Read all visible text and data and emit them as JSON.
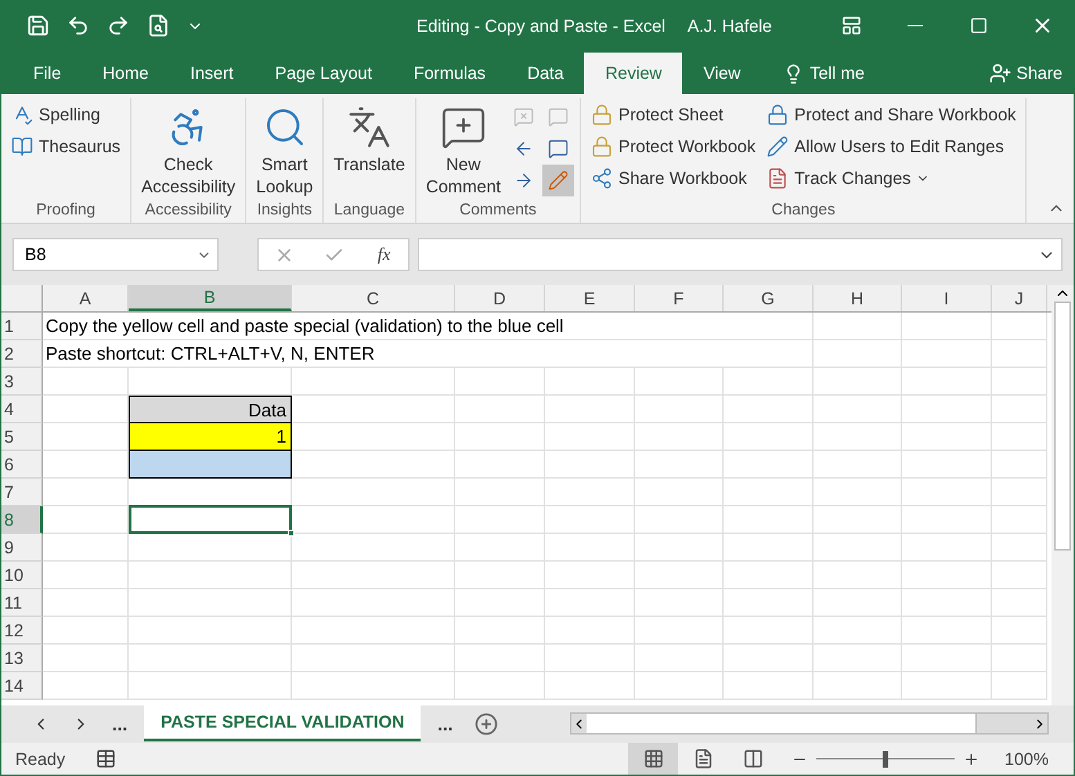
{
  "window": {
    "title": "Editing - Copy and Paste  -  Excel",
    "user": "A.J. Hafele"
  },
  "tabs": [
    {
      "label": "File",
      "selected": false
    },
    {
      "label": "Home",
      "selected": false
    },
    {
      "label": "Insert",
      "selected": false
    },
    {
      "label": "Page Layout",
      "selected": false
    },
    {
      "label": "Formulas",
      "selected": false
    },
    {
      "label": "Data",
      "selected": false
    },
    {
      "label": "Review",
      "selected": true
    },
    {
      "label": "View",
      "selected": false
    }
  ],
  "tell_me": "Tell me",
  "share": "Share",
  "ribbon": [
    {
      "label": "Proofing",
      "kind": "stack",
      "commands": [
        {
          "label": "Spelling"
        },
        {
          "label": "Thesaurus"
        }
      ]
    },
    {
      "label": "Accessibility",
      "kind": "large",
      "commands": [
        {
          "label": "Check Accessibility"
        }
      ]
    },
    {
      "label": "Insights",
      "kind": "large",
      "commands": [
        {
          "label": "Smart Lookup"
        }
      ]
    },
    {
      "label": "Language",
      "kind": "large",
      "commands": [
        {
          "label": "Translate"
        }
      ]
    },
    {
      "label": "Comments",
      "kind": "comments",
      "commands": [
        {
          "label": "New Comment"
        }
      ],
      "icons": [
        {
          "disabled": true,
          "selected": false
        },
        {
          "disabled": true,
          "selected": false
        },
        {
          "disabled": false,
          "selected": false
        },
        {
          "disabled": false,
          "selected": false
        },
        {
          "disabled": false,
          "selected": false
        },
        {
          "disabled": false,
          "selected": true
        }
      ]
    },
    {
      "label": "Changes",
      "kind": "columns",
      "commands": [
        {
          "label": "Protect Sheet"
        },
        {
          "label": "Protect Workbook"
        },
        {
          "label": "Share Workbook"
        },
        {
          "label": "Protect and Share Workbook"
        },
        {
          "label": "Allow Users to Edit Ranges"
        },
        {
          "label": "Track Changes",
          "dropdown": true
        }
      ]
    }
  ],
  "name_box": "B8",
  "fx": "fx",
  "columns": [
    {
      "label": "A",
      "selected": false
    },
    {
      "label": "B",
      "selected": true
    },
    {
      "label": "C",
      "selected": false
    },
    {
      "label": "D",
      "selected": false
    },
    {
      "label": "E",
      "selected": false
    },
    {
      "label": "F",
      "selected": false
    },
    {
      "label": "G",
      "selected": false
    },
    {
      "label": "H",
      "selected": false
    },
    {
      "label": "I",
      "selected": false
    },
    {
      "label": "J",
      "selected": false
    }
  ],
  "rows": [
    {
      "label": "1",
      "selected": false,
      "note": "Copy the yellow cell and paste special (validation) to the blue cell"
    },
    {
      "label": "2",
      "selected": false,
      "note": "Paste shortcut: CTRL+ALT+V, N, ENTER"
    },
    {
      "label": "3",
      "selected": false
    },
    {
      "label": "4",
      "selected": false,
      "b_cell": {
        "kind": "table",
        "text": "Data",
        "color": "#d9d9d9"
      }
    },
    {
      "label": "5",
      "selected": false,
      "b_cell": {
        "kind": "table",
        "text": "1",
        "color": "#ffff00"
      }
    },
    {
      "label": "6",
      "selected": false,
      "b_cell": {
        "kind": "table",
        "color": "#bdd7ee"
      }
    },
    {
      "label": "7",
      "selected": false
    },
    {
      "label": "8",
      "selected": true,
      "b_cell": {
        "kind": "active"
      }
    },
    {
      "label": "9",
      "selected": false
    },
    {
      "label": "10",
      "selected": false
    },
    {
      "label": "11",
      "selected": false
    },
    {
      "label": "12",
      "selected": false
    },
    {
      "label": "13",
      "selected": false
    },
    {
      "label": "14",
      "selected": false
    }
  ],
  "sheet_tabs": {
    "before": "...",
    "after": "...",
    "tabs": [
      {
        "label": "PASTE SPECIAL VALIDATION",
        "selected": true
      }
    ]
  },
  "status": {
    "text": "Ready",
    "zoom": "100%",
    "zoom_slider": {
      "level": 0.5
    },
    "views": [
      {
        "selected": true
      },
      {
        "selected": false
      },
      {
        "selected": false
      }
    ]
  }
}
